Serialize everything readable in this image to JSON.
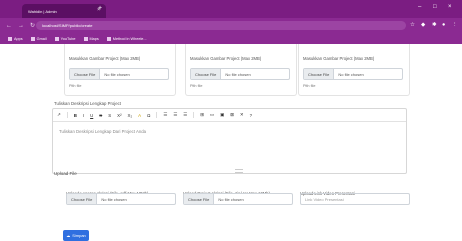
{
  "browser": {
    "tab_title": "Wahidin | Admin",
    "url": "localhost/SIMP/public/create",
    "bookmarks": [
      "Apps",
      "Gmail",
      "YouTube",
      "Maps",
      "Method in Wheele..."
    ]
  },
  "gallery_cards": [
    {
      "label": "Masukkan Gambar Project (Max 2MB)",
      "button": "Choose File",
      "status": "No file chosen",
      "note": "Pith file"
    },
    {
      "label": "Masukkan Gambar Project (Max 2MB)",
      "button": "Choose File",
      "status": "No file chosen",
      "note": "Pith file"
    },
    {
      "label": "Masukkan Gambar Project (Max 2MB)",
      "button": "Choose File",
      "status": "No file chosen",
      "note": "Pith file"
    }
  ],
  "description": {
    "label": "Tuliskan Deskripsi Lengkap Project",
    "placeholder": "Tuliskan Deskripsi Lengkap Dari Project Anda"
  },
  "toolbar": [
    "↗",
    "B",
    "I",
    "U",
    "S",
    "S",
    "X²",
    "X₂",
    "A",
    "Ω",
    "☰",
    "☰",
    "☰",
    "⊞",
    "▭",
    "▣",
    "⊠",
    "✕",
    "?"
  ],
  "uploads": {
    "heading": "Upload File",
    "laporan": {
      "label": "Upload Laporan skripsi (File .pdf Max 10Mb)",
      "button": "Choose File",
      "status": "No file chosen"
    },
    "project": {
      "label": "Upload Project skripsi (File .zip/.rar Max 10Mb)",
      "button": "Choose File",
      "status": "No file chosen"
    },
    "video": {
      "label": "Upload Link Video Presentasi",
      "placeholder": "Link Video Presentasi"
    }
  },
  "submit_label": "Simpan"
}
